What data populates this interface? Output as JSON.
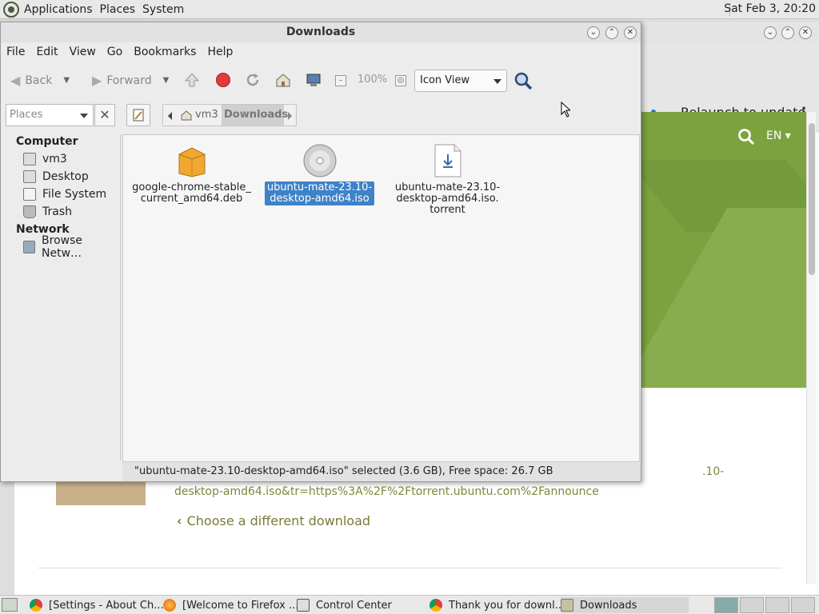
{
  "top_panel": {
    "menus": [
      "Applications",
      "Places",
      "System"
    ],
    "clock": "Sat Feb  3, 20:20"
  },
  "browser": {
    "relaunch_label": "Relaunch to update",
    "language": "EN",
    "download_link_partial": ".10-desktop-amd64.iso&tr=https%3A%2F%2Ftorrent.ubuntu.com%2Fannounce",
    "choose_label": "Choose a different download"
  },
  "file_manager": {
    "title": "Downloads",
    "menubar": [
      "File",
      "Edit",
      "View",
      "Go",
      "Bookmarks",
      "Help"
    ],
    "toolbar": {
      "back_label": "Back",
      "forward_label": "Forward",
      "zoom_level": "100%",
      "view_mode": "Icon View"
    },
    "location": {
      "places_label": "Places",
      "crumbs": [
        "vm3",
        "Downloads"
      ]
    },
    "sidebar": {
      "sections": [
        {
          "heading": "Computer",
          "items": [
            "vm3",
            "Desktop",
            "File System",
            "Trash"
          ]
        },
        {
          "heading": "Network",
          "items": [
            "Browse Netw…"
          ]
        }
      ]
    },
    "files": [
      {
        "name": "google-chrome-stable_\ncurrent_amd64.deb",
        "type": "package",
        "selected": false
      },
      {
        "name": "ubuntu-mate-23.10-\ndesktop-amd64.iso",
        "type": "disc-image",
        "selected": true
      },
      {
        "name": "ubuntu-mate-23.10-\ndesktop-amd64.iso.\ntorrent",
        "type": "torrent",
        "selected": false
      }
    ],
    "status": "\"ubuntu-mate-23.10-desktop-amd64.iso\" selected (3.6 GB), Free space: 26.7 GB"
  },
  "taskbar": {
    "tasks": [
      {
        "label": "[Settings - About Ch...",
        "icon": "chrome-icon"
      },
      {
        "label": "[Welcome to Firefox ...",
        "icon": "firefox-icon"
      },
      {
        "label": "Control Center",
        "icon": "control-center-icon"
      },
      {
        "label": "Thank you for downl...",
        "icon": "chrome-icon"
      },
      {
        "label": "Downloads",
        "icon": "folder-icon"
      }
    ]
  },
  "colors": {
    "selection": "#3e82c8",
    "ubuntu_green": "#7ba23f",
    "link_green": "#7a8a3a"
  }
}
